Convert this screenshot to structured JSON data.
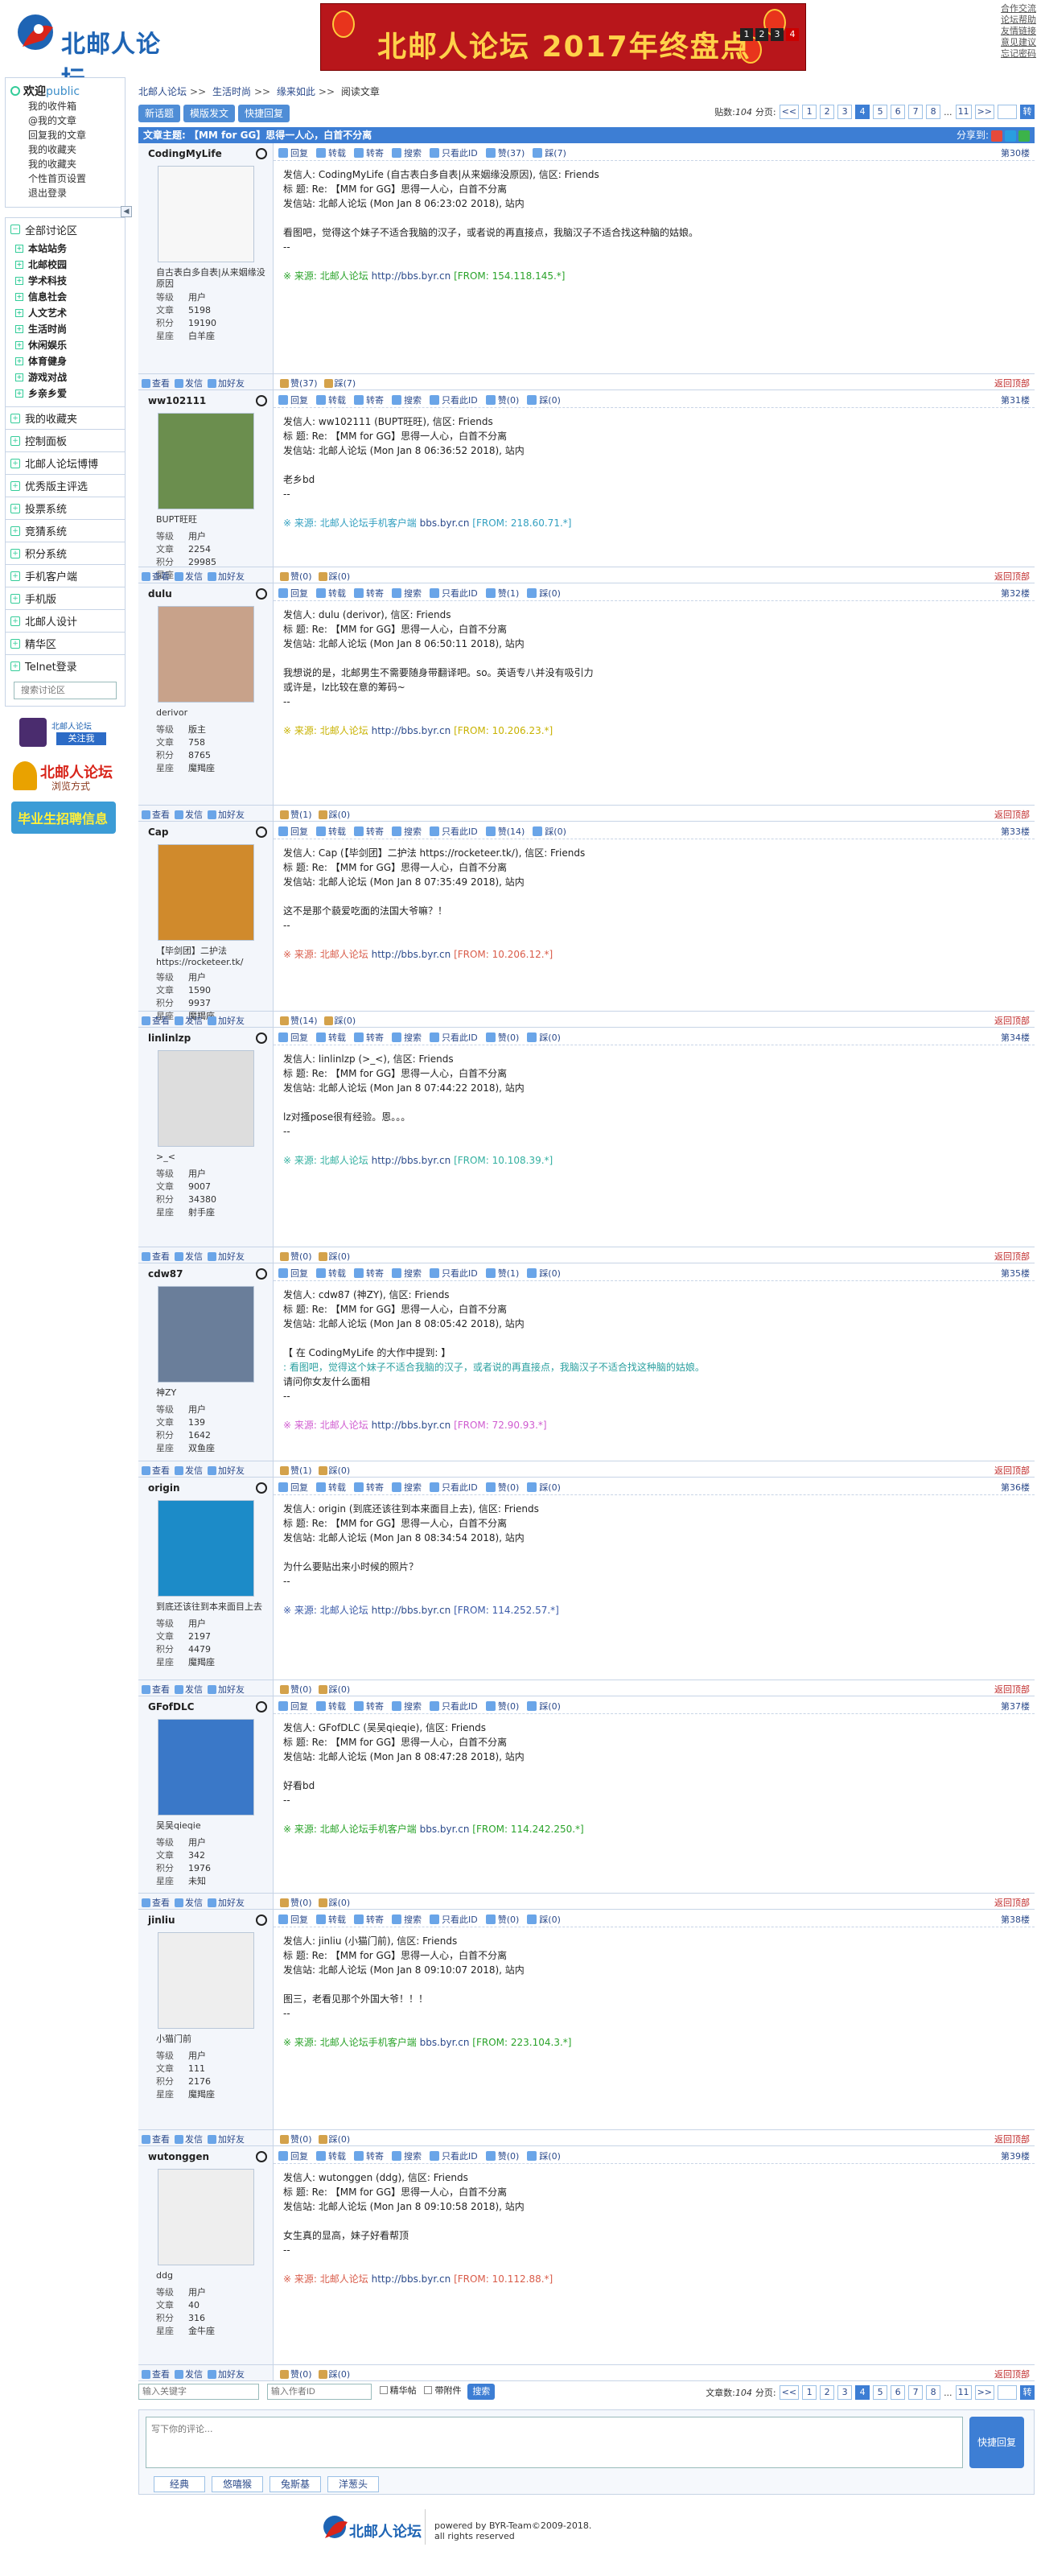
{
  "header": {
    "logo_text": "北邮人论坛",
    "banner_text": "北邮人论坛 2017年终盘点",
    "banner_pages": [
      "1",
      "2",
      "3",
      "4"
    ],
    "toplinks": [
      "合作交流",
      "论坛帮助",
      "友情链接",
      "意见建议",
      "忘记密码"
    ]
  },
  "sidebar": {
    "welcome": "欢迎",
    "user": "public",
    "links": [
      "我的收件箱",
      "@我的文章",
      "回复我的文章",
      "我的收藏夹",
      "我的收藏夹",
      "个性首页设置",
      "退出登录"
    ],
    "section_all": "全部讨论区",
    "sections": [
      "本站站务",
      "北邮校园",
      "学术科技",
      "信息社会",
      "人文艺术",
      "生活时尚",
      "休闲娱乐",
      "体育健身",
      "游戏对战",
      "乡亲乡爱"
    ],
    "others": [
      "我的收藏夹",
      "控制面板",
      "北邮人论坛博博",
      "优秀版主评选",
      "投票系统",
      "竞猜系统",
      "积分系统",
      "手机客户端",
      "手机版",
      "北邮人设计",
      "精华区",
      "Telnet登录"
    ],
    "search_placeholder": "搜索讨论区",
    "promo1_text": "北邮人论坛",
    "promo1_btn": "关注我",
    "promo2_title": "北邮人论坛",
    "promo2_sub": "浏览方式",
    "promo3": "毕业生招聘信息"
  },
  "breadcrumb": [
    "北邮人论坛",
    "生活时尚",
    "缘来如此",
    "阅读文章"
  ],
  "toolbar": {
    "buttons": [
      "新话题",
      "模版发文",
      "快捷回复"
    ],
    "count_label": "贴数:",
    "count": "104",
    "page_label": "分页:",
    "pages": [
      "<<",
      "1",
      "2",
      "3",
      "4",
      "5",
      "6",
      "7",
      "8",
      "...",
      "11",
      ">>"
    ],
    "current": "4",
    "go": "转"
  },
  "title": {
    "label": "文章主题: 【MM for GG】思得一人心，白首不分离",
    "share": "分享到:"
  },
  "actions": [
    "回复",
    "转载",
    "转寄",
    "搜索",
    "只看此ID",
    "赞",
    "踩"
  ],
  "bottom_actions": [
    "查看",
    "发信",
    "加好友"
  ],
  "totop": "返回顶部",
  "stats_labels": [
    "等级",
    "文章",
    "积分",
    "星座"
  ],
  "posts": [
    {
      "floor": "第30楼",
      "user": "CodingMyLife",
      "nick": "",
      "sig": "自古表白多自表|从来姻缘没原因",
      "level": "用户",
      "articles": "5198",
      "points": "19190",
      "sign": "白羊座",
      "from": "CodingMyLife (自古表白多自表|从来姻缘没原因)",
      "time": "Mon Jan  8 06:23:02 2018",
      "body": "看图吧，觉得这个妹子不适合我脑的汉子，或者说的再直接点，我脑汉子不适合找这种脑的姑娘。",
      "source": "北邮人论坛",
      "url": "http://bbs.byr.cn",
      "ip": "[FROM: 154.118.145.*]",
      "like": "赞(37)",
      "dislike": "踩(7)",
      "srccolor": "#2aa32a"
    },
    {
      "floor": "第31楼",
      "user": "ww102111",
      "nick": "BUPT旺旺",
      "sig": "",
      "level": "用户",
      "articles": "2254",
      "points": "29985",
      "sign": "",
      "from": "ww102111 (BUPT旺旺)",
      "time": "Mon Jan  8 06:36:52 2018",
      "body": "老乡bd",
      "source": "北邮人论坛手机客户端",
      "url": "bbs.byr.cn",
      "ip": "[FROM: 218.60.71.*]",
      "like": "赞(0)",
      "dislike": "踩(0)",
      "srccolor": "#33a0c0"
    },
    {
      "floor": "第32楼",
      "user": "dulu",
      "nick": "derivor",
      "sig": "",
      "level": "版主",
      "articles": "758",
      "points": "8765",
      "sign": "魔羯座",
      "from": "dulu (derivor)",
      "time": "Mon Jan  8 06:50:11 2018",
      "body": "我想说的是，北邮男生不需要随身带翻译吧。so。英语专八并没有吸引力\n或许是，lz比较在意的筹码~",
      "source": "北邮人论坛",
      "url": "http://bbs.byr.cn",
      "ip": "[FROM: 10.206.23.*]",
      "like": "赞(1)",
      "dislike": "踩(0)",
      "srccolor": "#c8b200"
    },
    {
      "floor": "第33楼",
      "user": "Cap",
      "nick": "【毕剑团】二护法 https://rocketeer.tk/",
      "sig": "",
      "level": "用户",
      "articles": "1590",
      "points": "9937",
      "sign": "魔羯座",
      "from": "Cap (【毕剑团】二护法 https://rocketeer.tk/)",
      "time": "Mon Jan  8 07:35:49 2018",
      "body": "这不是那个藐爱吃面的法国大爷嘛？！",
      "source": "北邮人论坛",
      "url": "http://bbs.byr.cn",
      "ip": "[FROM: 10.206.12.*]",
      "like": "赞(14)",
      "dislike": "踩(0)",
      "srccolor": "#d95c4a"
    },
    {
      "floor": "第34楼",
      "user": "linlinlzp",
      "nick": ">_<",
      "sig": "",
      "level": "用户",
      "articles": "9007",
      "points": "34380",
      "sign": "射手座",
      "from": "linlinlzp (>_<)",
      "time": "Mon Jan  8 07:44:22 2018",
      "body": "lz对搔pose很有经验。恩。。。",
      "source": "北邮人论坛",
      "url": "http://bbs.byr.cn",
      "ip": "[FROM: 10.108.39.*]",
      "like": "赞(0)",
      "dislike": "踩(0)",
      "srccolor": "#33b0a0"
    },
    {
      "floor": "第35楼",
      "user": "cdw87",
      "nick": "神ZY",
      "sig": "",
      "level": "用户",
      "articles": "139",
      "points": "1642",
      "sign": "双鱼座",
      "from": "cdw87 (神ZY)",
      "time": "Mon Jan  8 08:05:42 2018",
      "body": "【 在 CodingMyLife 的大作中提到: 】\n: 看图吧，觉得这个妹子不适合我脑的汉子，或者说的再直接点，我脑汉子不适合找这种脑的姑娘。\n请问你女友什么面相",
      "source": "北邮人论坛",
      "url": "http://bbs.byr.cn",
      "ip": "[FROM: 72.90.93.*]",
      "like": "赞(1)",
      "dislike": "踩(0)",
      "srccolor": "#d05cd0"
    },
    {
      "floor": "第36楼",
      "user": "origin",
      "nick": "到底还该往到本来面目上去",
      "sig": "",
      "level": "用户",
      "articles": "2197",
      "points": "4479",
      "sign": "魔羯座",
      "from": "origin (到底还该往到本来面目上去)",
      "time": "Mon Jan  8 08:34:54 2018",
      "body": "为什么要贴出来小时候的照片？",
      "source": "北邮人论坛",
      "url": "http://bbs.byr.cn",
      "ip": "[FROM: 114.252.57.*]",
      "like": "赞(0)",
      "dislike": "踩(0)",
      "srccolor": "#3a5aa8"
    },
    {
      "floor": "第37楼",
      "user": "GFofDLC",
      "nick": "吴吴qieqie",
      "sig": "",
      "level": "用户",
      "articles": "342",
      "points": "1976",
      "sign": "未知",
      "from": "GFofDLC (吴吴qieqie)",
      "time": "Mon Jan  8 08:47:28 2018",
      "body": "好看bd",
      "source": "北邮人论坛手机客户端",
      "url": "bbs.byr.cn",
      "ip": "[FROM: 114.242.250.*]",
      "like": "赞(0)",
      "dislike": "踩(0)",
      "srccolor": "#2aa32a"
    },
    {
      "floor": "第38楼",
      "user": "jinliu",
      "nick": "小猫门前",
      "sig": "",
      "level": "用户",
      "articles": "111",
      "points": "2176",
      "sign": "魔羯座",
      "from": "jinliu (小猫门前)",
      "time": "Mon Jan  8 09:10:07 2018",
      "body": "图三，老看见那个外国大爷！！！",
      "source": "北邮人论坛手机客户端",
      "url": "bbs.byr.cn",
      "ip": "[FROM: 223.104.3.*]",
      "like": "赞(0)",
      "dislike": "踩(0)",
      "srccolor": "#2aa32a"
    },
    {
      "floor": "第39楼",
      "user": "wutonggen",
      "nick": "ddg",
      "sig": "",
      "level": "用户",
      "articles": "40",
      "points": "316",
      "sign": "金牛座",
      "from": "wutonggen (ddg)",
      "time": "Mon Jan  8 09:10:58 2018",
      "body": "女生真的显高，妹子好看帮顶",
      "source": "北邮人论坛",
      "url": "http://bbs.byr.cn",
      "ip": "[FROM: 10.112.88.*]",
      "like": "赞(0)",
      "dislike": "踩(0)",
      "srccolor": "#d95c4a"
    }
  ],
  "post_header": {
    "from_label": "发信人:",
    "board": "信区: Friends",
    "title": "标  题: Re: 【MM for GG】思得一人心，白首不分离",
    "station_label": "发信站: 北邮人论坛",
    "suffix": "站内",
    "dash": "--",
    "source_prefix": "※ 来源:"
  },
  "bottom": {
    "kw_placeholder": "输入关键字",
    "author_placeholder": "输入作者ID",
    "chk1": "精华帖",
    "chk2": "带附件",
    "search": "搜索"
  },
  "reply": {
    "placeholder": "写下你的评论...",
    "send": "快捷回复",
    "emotes": [
      "经典",
      "悠嘻猴",
      "兔斯基",
      "洋葱头"
    ]
  },
  "footer": {
    "logo": "北邮人论坛",
    "line1": "powered by BYR-Team©2009-2018.",
    "line2": "all rights reserved"
  },
  "colors": {
    "accent": "#3d7ed4",
    "border": "#c7d4e6",
    "link": "#2b4a8b"
  }
}
